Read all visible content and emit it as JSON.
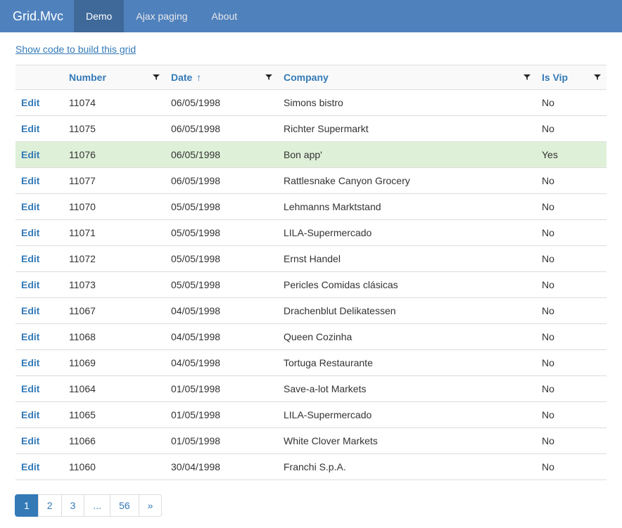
{
  "navbar": {
    "brand": "Grid.Mvc",
    "items": [
      {
        "label": "Demo",
        "active": true
      },
      {
        "label": "Ajax paging",
        "active": false
      },
      {
        "label": "About",
        "active": false
      }
    ]
  },
  "show_code_label": "Show code to build this grid",
  "grid": {
    "edit_label": "Edit",
    "columns": {
      "number": {
        "label": "Number",
        "sort": null
      },
      "date": {
        "label": "Date",
        "sort": "↑"
      },
      "company": {
        "label": "Company",
        "sort": null
      },
      "vip": {
        "label": "Is Vip",
        "sort": null
      }
    },
    "rows": [
      {
        "number": "11074",
        "date": "06/05/1998",
        "company": "Simons bistro",
        "vip": "No"
      },
      {
        "number": "11075",
        "date": "06/05/1998",
        "company": "Richter Supermarkt",
        "vip": "No"
      },
      {
        "number": "11076",
        "date": "06/05/1998",
        "company": "Bon app'",
        "vip": "Yes"
      },
      {
        "number": "11077",
        "date": "06/05/1998",
        "company": "Rattlesnake Canyon Grocery",
        "vip": "No"
      },
      {
        "number": "11070",
        "date": "05/05/1998",
        "company": "Lehmanns Marktstand",
        "vip": "No"
      },
      {
        "number": "11071",
        "date": "05/05/1998",
        "company": "LILA-Supermercado",
        "vip": "No"
      },
      {
        "number": "11072",
        "date": "05/05/1998",
        "company": "Ernst Handel",
        "vip": "No"
      },
      {
        "number": "11073",
        "date": "05/05/1998",
        "company": "Pericles Comidas clásicas",
        "vip": "No"
      },
      {
        "number": "11067",
        "date": "04/05/1998",
        "company": "Drachenblut Delikatessen",
        "vip": "No"
      },
      {
        "number": "11068",
        "date": "04/05/1998",
        "company": "Queen Cozinha",
        "vip": "No"
      },
      {
        "number": "11069",
        "date": "04/05/1998",
        "company": "Tortuga Restaurante",
        "vip": "No"
      },
      {
        "number": "11064",
        "date": "01/05/1998",
        "company": "Save-a-lot Markets",
        "vip": "No"
      },
      {
        "number": "11065",
        "date": "01/05/1998",
        "company": "LILA-Supermercado",
        "vip": "No"
      },
      {
        "number": "11066",
        "date": "01/05/1998",
        "company": "White Clover Markets",
        "vip": "No"
      },
      {
        "number": "11060",
        "date": "30/04/1998",
        "company": "Franchi S.p.A.",
        "vip": "No"
      }
    ]
  },
  "pagination": {
    "pages": [
      "1",
      "2",
      "3",
      "...",
      "56",
      "»"
    ],
    "active_index": 0
  }
}
